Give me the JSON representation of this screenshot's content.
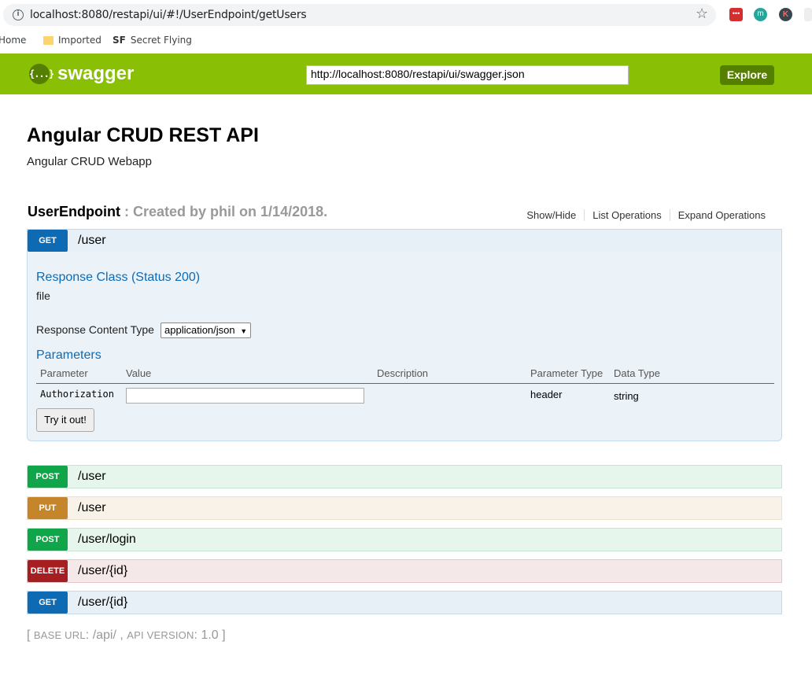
{
  "browser": {
    "url": "localhost:8080/restapi/ui/#!/UserEndpoint/getUsers",
    "bookmarks": [
      {
        "label": "Home",
        "icon": "home-icon"
      },
      {
        "label": "Imported",
        "icon": "folder-icon"
      },
      {
        "label": "Secret Flying",
        "icon": "sf-icon",
        "glyph": "SF"
      }
    ]
  },
  "header": {
    "logo_text": "swagger",
    "logo_glyph": "{...}",
    "spec_url": "http://localhost:8080/restapi/ui/swagger.json",
    "explore_label": "Explore",
    "accent": "#89bf04"
  },
  "info": {
    "title": "Angular CRUD REST API",
    "description": "Angular CRUD Webapp"
  },
  "resource": {
    "name": "UserEndpoint",
    "description": ": Created by phil on 1/14/2018.",
    "links": [
      "Show/Hide",
      "List Operations",
      "Expand Operations"
    ]
  },
  "operations": [
    {
      "method": "GET",
      "path": "/user",
      "expanded": true
    },
    {
      "method": "POST",
      "path": "/user"
    },
    {
      "method": "PUT",
      "path": "/user"
    },
    {
      "method": "POST",
      "path": "/user/login"
    },
    {
      "method": "DELETE",
      "path": "/user/{id}"
    },
    {
      "method": "GET",
      "path": "/user/{id}"
    }
  ],
  "expanded_op": {
    "response_class_label": "Response Class (Status 200)",
    "response_class_value": "file",
    "content_type_label": "Response Content Type",
    "content_type_value": "application/json",
    "parameters_title": "Parameters",
    "param_headers": [
      "Parameter",
      "Value",
      "Description",
      "Parameter Type",
      "Data Type"
    ],
    "params": [
      {
        "name": "Authorization",
        "value": "",
        "description": "",
        "type": "header",
        "data_type": "string"
      }
    ],
    "try_label": "Try it out!"
  },
  "footer": {
    "open": "[ ",
    "base_url_label": "BASE URL",
    "base_url_value": ": /api/ , ",
    "api_version_label": "API VERSION",
    "api_version_value": ": 1.0 ]"
  }
}
